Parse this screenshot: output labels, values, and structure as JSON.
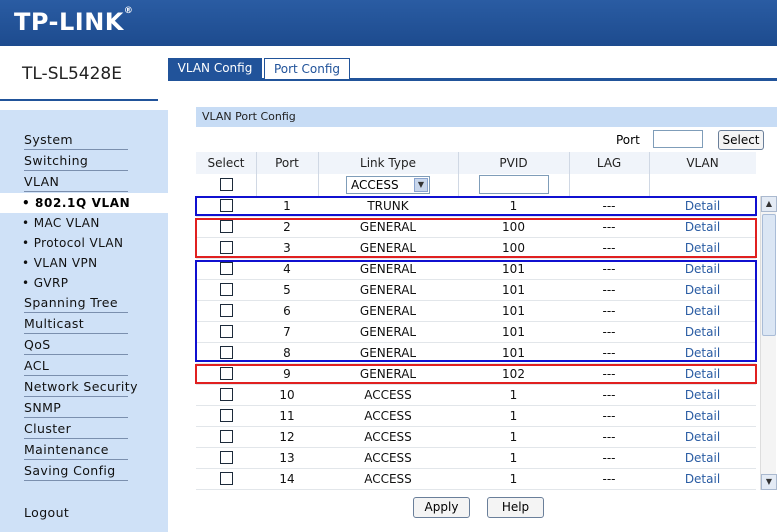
{
  "brand": {
    "logo": "TP-LINK",
    "reg": "®",
    "model": "TL-SL5428E"
  },
  "nav": {
    "items": [
      "System",
      "Switching",
      "VLAN"
    ],
    "sub_active": "• 802.1Q VLAN",
    "subs": [
      "• MAC VLAN",
      "• Protocol VLAN",
      "• VLAN VPN",
      "• GVRP"
    ],
    "items2": [
      "Spanning Tree",
      "Multicast",
      "QoS",
      "ACL",
      "Network Security",
      "SNMP",
      "Cluster",
      "Maintenance",
      "Saving Config"
    ],
    "logout": "Logout"
  },
  "tabs": [
    "VLAN Config",
    "Port Config"
  ],
  "panel": {
    "title": "VLAN Port Config",
    "port_label": "Port",
    "port_value": "",
    "select_button": "Select",
    "headers": [
      "Select",
      "Port",
      "Link Type",
      "PVID",
      "LAG",
      "VLAN"
    ],
    "link_type_filter": "ACCESS",
    "pvid_filter": ""
  },
  "rows": [
    {
      "port": "1",
      "type": "TRUNK",
      "pvid": "1",
      "lag": "---",
      "vlan": "Detail"
    },
    {
      "port": "2",
      "type": "GENERAL",
      "pvid": "100",
      "lag": "---",
      "vlan": "Detail"
    },
    {
      "port": "3",
      "type": "GENERAL",
      "pvid": "100",
      "lag": "---",
      "vlan": "Detail"
    },
    {
      "port": "4",
      "type": "GENERAL",
      "pvid": "101",
      "lag": "---",
      "vlan": "Detail"
    },
    {
      "port": "5",
      "type": "GENERAL",
      "pvid": "101",
      "lag": "---",
      "vlan": "Detail"
    },
    {
      "port": "6",
      "type": "GENERAL",
      "pvid": "101",
      "lag": "---",
      "vlan": "Detail"
    },
    {
      "port": "7",
      "type": "GENERAL",
      "pvid": "101",
      "lag": "---",
      "vlan": "Detail"
    },
    {
      "port": "8",
      "type": "GENERAL",
      "pvid": "101",
      "lag": "---",
      "vlan": "Detail"
    },
    {
      "port": "9",
      "type": "GENERAL",
      "pvid": "102",
      "lag": "---",
      "vlan": "Detail"
    },
    {
      "port": "10",
      "type": "ACCESS",
      "pvid": "1",
      "lag": "---",
      "vlan": "Detail"
    },
    {
      "port": "11",
      "type": "ACCESS",
      "pvid": "1",
      "lag": "---",
      "vlan": "Detail"
    },
    {
      "port": "12",
      "type": "ACCESS",
      "pvid": "1",
      "lag": "---",
      "vlan": "Detail"
    },
    {
      "port": "13",
      "type": "ACCESS",
      "pvid": "1",
      "lag": "---",
      "vlan": "Detail"
    },
    {
      "port": "14",
      "type": "ACCESS",
      "pvid": "1",
      "lag": "---",
      "vlan": "Detail"
    }
  ],
  "buttons": {
    "apply": "Apply",
    "help": "Help"
  },
  "colors": {
    "brand_blue": "#21539a",
    "sidebar": "#cfe1f7",
    "highlight_blue": "#1010d0",
    "highlight_red": "#e02020"
  }
}
